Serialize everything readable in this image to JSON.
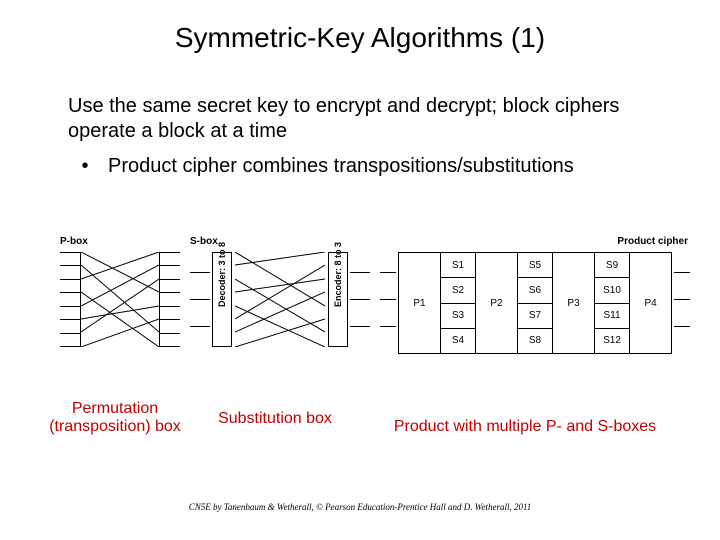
{
  "title": "Symmetric-Key Algorithms (1)",
  "body": {
    "para": "Use the same secret key to encrypt and decrypt; block ciphers operate a block at a time",
    "bullet": "Product cipher combines transpositions/substitutions"
  },
  "figure": {
    "pbox_label": "P-box",
    "sbox_label": "S-box",
    "product_label": "Product cipher",
    "decoder_label": "Decoder: 3 to 8",
    "encoder_label": "Encoder: 8 to 3",
    "p_cells": [
      "P1",
      "P2",
      "P3",
      "P4"
    ],
    "s_cells": [
      "S1",
      "S2",
      "S3",
      "S4",
      "S5",
      "S6",
      "S7",
      "S8",
      "S9",
      "S10",
      "S11",
      "S12"
    ]
  },
  "captions": {
    "permutation": "Permutation (transposition) box",
    "substitution": "Substitution box",
    "product": "Product with multiple P- and S-boxes"
  },
  "footer": "CN5E by Tanenbaum & Wetherall, © Pearson Education-Prentice Hall and D. Wetherall, 2011"
}
